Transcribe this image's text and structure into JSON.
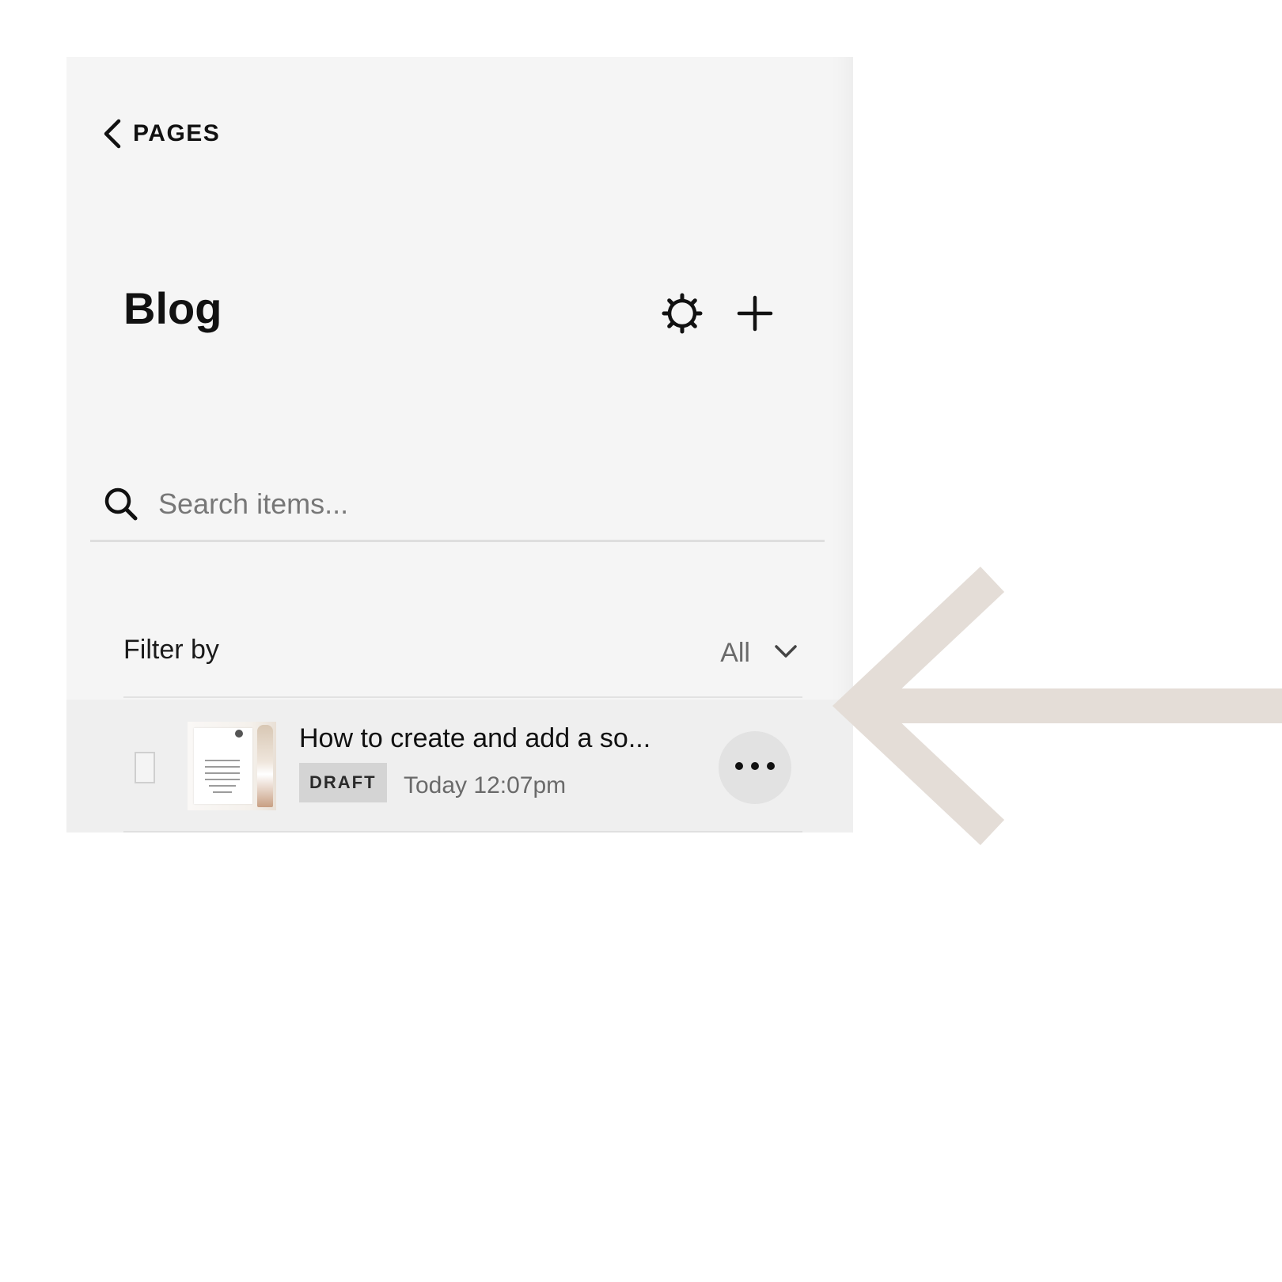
{
  "header": {
    "back_label": "PAGES",
    "back_icon": "chevron-left-icon",
    "title": "Blog",
    "settings_icon": "gear-icon",
    "add_icon": "plus-icon"
  },
  "search": {
    "icon": "search-icon",
    "placeholder": "Search items...",
    "value": ""
  },
  "filter": {
    "label": "Filter by",
    "selected": "All",
    "icon": "chevron-down-icon"
  },
  "items": [
    {
      "title": "How to create and add a so...",
      "status": "DRAFT",
      "date": "Today 12:07pm",
      "more_icon": "more-horizontal-icon"
    }
  ],
  "annotation": {
    "arrow_icon": "arrow-left-icon",
    "color": "#e4ddd7"
  },
  "colors": {
    "panel_background": "#f5f5f5",
    "selected_row_background": "#efefef",
    "badge_background": "#d4d4d4",
    "text_primary": "#111111",
    "text_secondary": "#6a6a6a"
  }
}
